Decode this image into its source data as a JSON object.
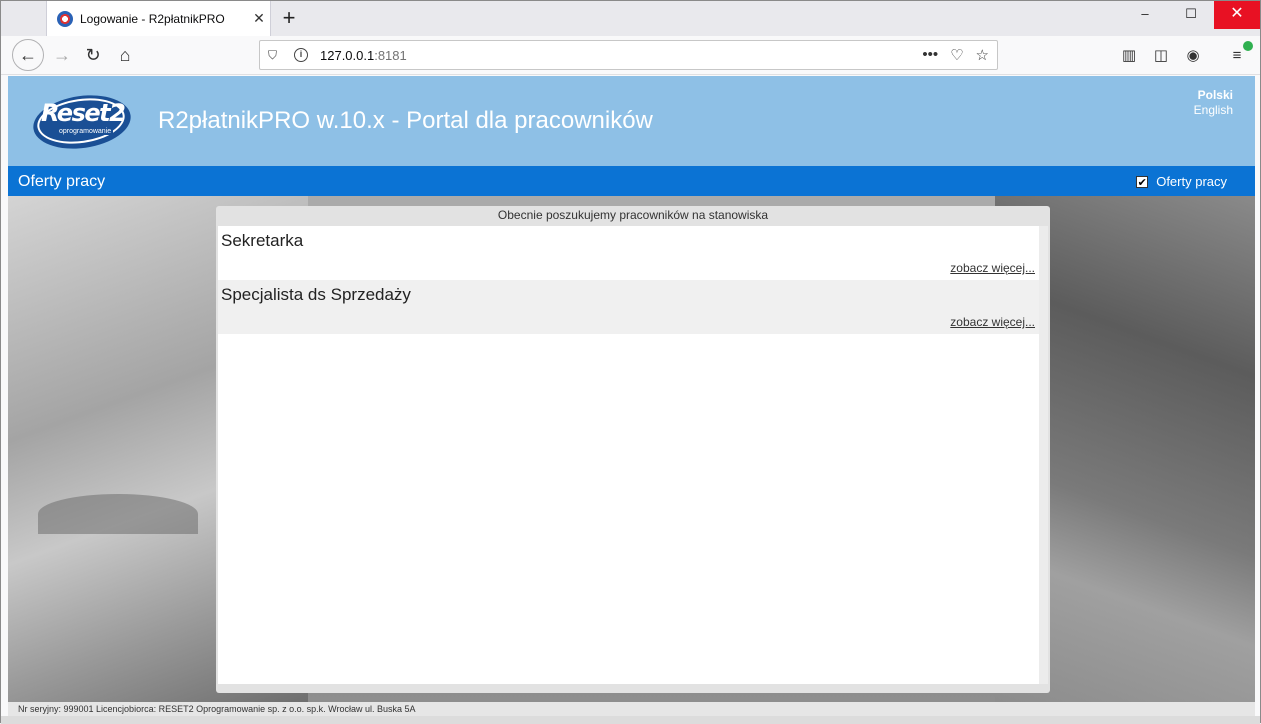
{
  "browser": {
    "tab_title": "Logowanie - R2płatnikPRO",
    "new_tab": "+",
    "url_host": "127.0.0.1",
    "url_port": ":8181",
    "window_controls": {
      "minimize": "–",
      "maximize": "☐",
      "close": "✕"
    }
  },
  "header": {
    "logo_text": "Reset2",
    "logo_sub": "oprogramowanie",
    "title": "R2płatnikPRO w.10.x - Portal dla pracowników",
    "languages": [
      "Polski",
      "English"
    ]
  },
  "menubar": {
    "item": "Oferty pracy",
    "checkbox_label": "Oferty pracy",
    "checkbox_checked": true
  },
  "panel": {
    "heading": "Obecnie poszukujemy pracowników na stanowiska",
    "jobs": [
      {
        "title": "Sekretarka",
        "more": "zobacz więcej..."
      },
      {
        "title": "Specjalista ds Sprzedaży",
        "more": "zobacz więcej..."
      }
    ]
  },
  "footer": {
    "text": "Nr seryjny: 999001 Licencjobiorca: RESET2 Oprogramowanie sp. z o.o. sp.k. Wrocław ul. Buska 5A"
  }
}
